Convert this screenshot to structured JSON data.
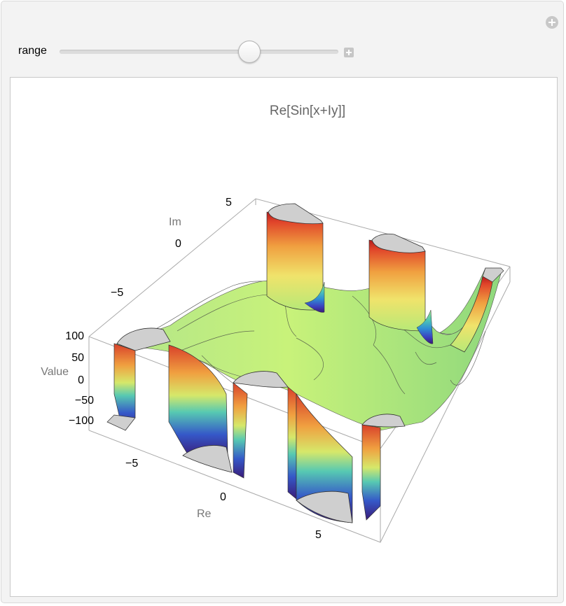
{
  "panel": {
    "add_icon": "plus-circle-icon",
    "slider": {
      "label": "range",
      "value_fraction": 0.68,
      "expand_icon": "plus-square-icon"
    }
  },
  "plot": {
    "title": "Re[Sin[x+Iy]]",
    "axes": {
      "im_label": "Im",
      "im_ticks": [
        "5",
        "0",
        "−5"
      ],
      "value_label": "Value",
      "value_ticks": [
        "100",
        "50",
        "0",
        "−50",
        "−100"
      ],
      "re_label": "Re",
      "re_ticks": [
        "−5",
        "0",
        "5"
      ]
    }
  },
  "chart_data": {
    "type": "surface3d",
    "function": "Re[Sin[x+Iy]]",
    "xlabel": "Re",
    "ylabel": "Im",
    "zlabel": "Value",
    "xlim": [
      -7,
      7
    ],
    "ylim": [
      -7,
      7
    ],
    "zlim": [
      -100,
      100
    ],
    "colors": [
      "#3b1d7a",
      "#3a4ec9",
      "#2fa7d6",
      "#5fd0a0",
      "#b6ec7a",
      "#f3e36a",
      "#f2a142",
      "#e2452a",
      "#b9201e"
    ],
    "cap_color": "#cfcfcf",
    "mesh_contours": true
  }
}
